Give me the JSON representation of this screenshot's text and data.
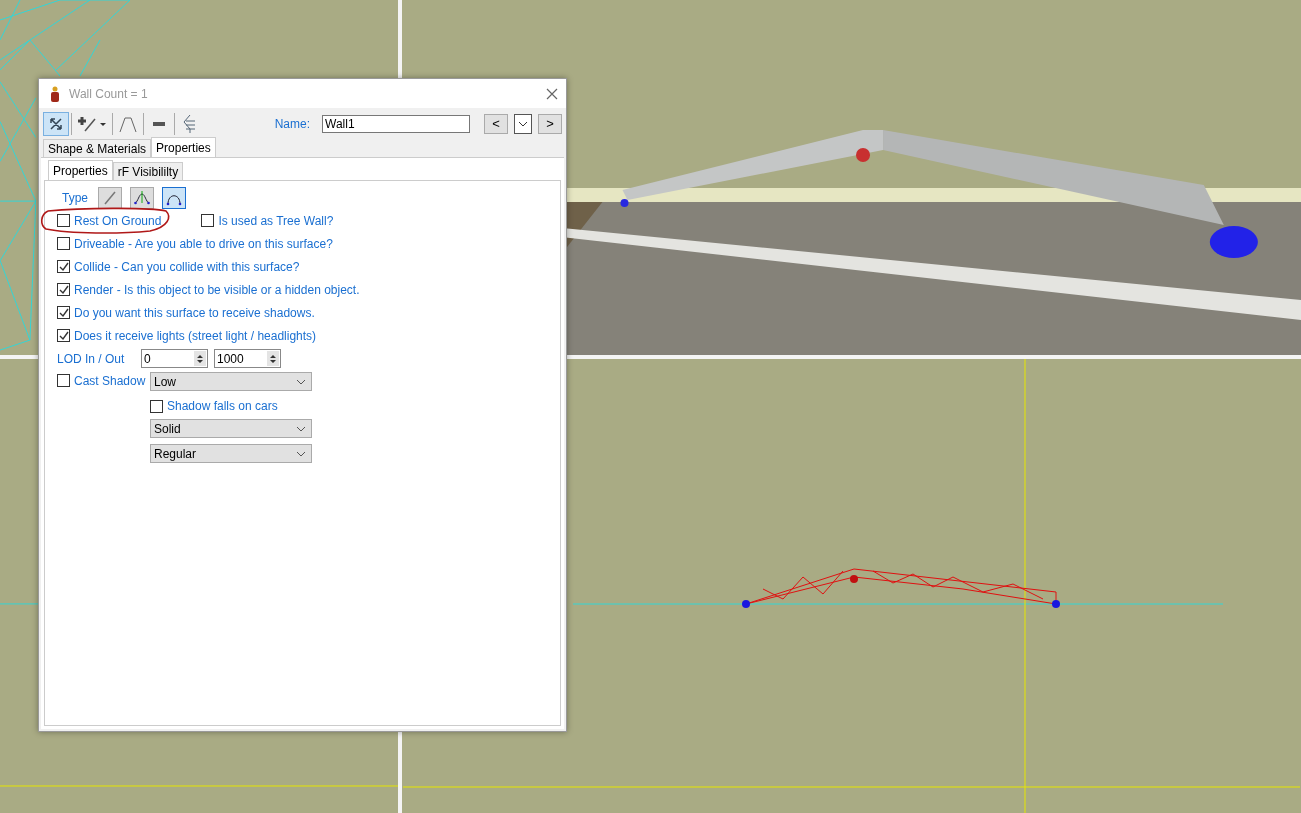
{
  "window": {
    "title": "Wall Count = 1"
  },
  "toolbar": [
    {
      "kind": "move",
      "selected": true
    },
    {
      "kind": "add",
      "selected": false
    },
    {
      "kind": "profile",
      "selected": false
    },
    {
      "kind": "flat",
      "selected": false
    },
    {
      "kind": "tree",
      "selected": false
    }
  ],
  "name_field": {
    "label": "Name:",
    "value": "Wall1"
  },
  "nav_buttons": [
    {
      "kind": "text",
      "label": "<"
    },
    {
      "kind": "dropdown"
    },
    {
      "kind": "text",
      "label": ">"
    }
  ],
  "tabs": [
    {
      "label": "Shape & Materials",
      "selected": false
    },
    {
      "label": "Properties",
      "selected": true
    }
  ],
  "subtabs": [
    {
      "label": "Properties",
      "selected": true
    },
    {
      "label": "rF Visibililty",
      "selected": false
    }
  ],
  "type": {
    "label": "Type",
    "options": [
      {
        "kind": "line",
        "selected": false
      },
      {
        "kind": "spline",
        "selected": false
      },
      {
        "kind": "arc",
        "selected": true
      }
    ]
  },
  "options": [
    {
      "items": [
        {
          "label": "Rest On Ground",
          "checked": false,
          "annotated": true
        },
        {
          "label": "Is used as Tree Wall?",
          "checked": false,
          "annotated": false
        }
      ]
    },
    {
      "items": [
        {
          "label": "Driveable - Are you able to drive on this surface?",
          "checked": false,
          "annotated": false
        }
      ]
    },
    {
      "items": [
        {
          "label": "Collide - Can you collide with this surface?",
          "checked": true,
          "annotated": false
        }
      ]
    },
    {
      "items": [
        {
          "label": "Render - Is this object to be visible or a hidden object.",
          "checked": true,
          "annotated": false
        }
      ]
    },
    {
      "items": [
        {
          "label": "Do you want this surface to receive shadows.",
          "checked": true,
          "annotated": false
        }
      ]
    },
    {
      "items": [
        {
          "label": "Does it receive lights (street light / headlights)",
          "checked": true,
          "annotated": false
        }
      ]
    }
  ],
  "lod": {
    "label": "LOD In / Out",
    "in": "0",
    "out": "1000"
  },
  "cast_shadow": {
    "label": "Cast Shadow",
    "checked": false,
    "quality": "Low"
  },
  "shadow_on_cars": {
    "label": "Shadow falls on cars",
    "checked": false
  },
  "dropdowns": [
    "Solid",
    "Regular"
  ]
}
